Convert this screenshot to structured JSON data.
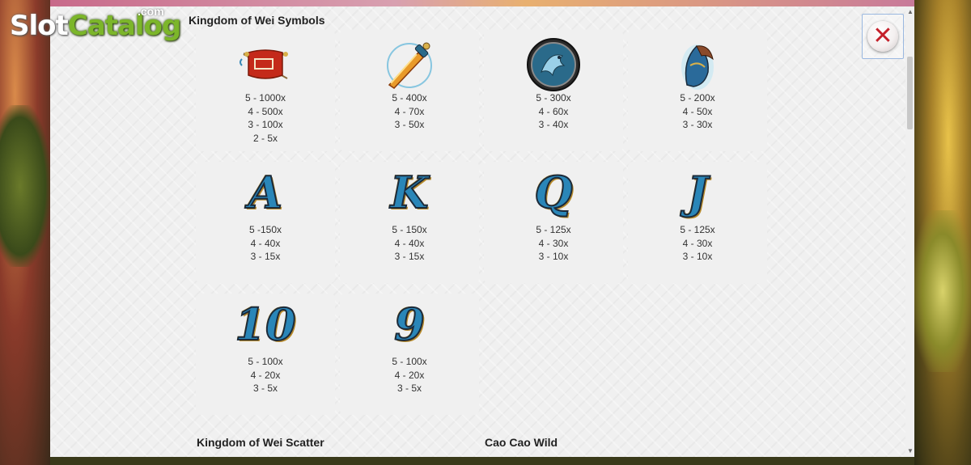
{
  "logo": {
    "slot": "Slot",
    "catalog": "Catalog",
    "com": ".com"
  },
  "paytable": {
    "section_title": "Kingdom of Wei Symbols",
    "symbols": [
      {
        "icon": "war-banner-icon",
        "pays": [
          "5 - 1000x",
          "4 - 500x",
          "3 - 100x",
          "2 - 5x"
        ]
      },
      {
        "icon": "sword-icon",
        "pays": [
          "5 - 400x",
          "4 - 70x",
          "3 - 50x"
        ]
      },
      {
        "icon": "dragon-shield-icon",
        "pays": [
          "5 - 300x",
          "4 - 60x",
          "3 - 40x"
        ]
      },
      {
        "icon": "war-horn-icon",
        "pays": [
          "5 - 200x",
          "4 - 50x",
          "3 - 30x"
        ]
      },
      {
        "icon": "letter-a-icon",
        "glyph": "A",
        "pays": [
          "5 -150x",
          "4 - 40x",
          "3 - 15x"
        ]
      },
      {
        "icon": "letter-k-icon",
        "glyph": "K",
        "pays": [
          "5 - 150x",
          "4 - 40x",
          "3 - 15x"
        ]
      },
      {
        "icon": "letter-q-icon",
        "glyph": "Q",
        "pays": [
          "5 - 125x",
          "4 - 30x",
          "3 - 10x"
        ]
      },
      {
        "icon": "letter-j-icon",
        "glyph": "J",
        "pays": [
          "5 - 125x",
          "4 - 30x",
          "3 - 10x"
        ]
      },
      {
        "icon": "number-10-icon",
        "glyph": "10",
        "pays": [
          "5 - 100x",
          "4 - 20x",
          "3 - 5x"
        ]
      },
      {
        "icon": "number-9-icon",
        "glyph": "9",
        "pays": [
          "5 - 100x",
          "4 - 20x",
          "3 - 5x"
        ]
      }
    ],
    "scatter_title": "Kingdom of Wei Scatter",
    "wild_title": "Cao Cao Wild"
  },
  "close_button": {
    "icon": "close-icon",
    "glyph": "✕"
  },
  "scrollbar": {
    "up_glyph": "▲",
    "down_glyph": "▼"
  }
}
